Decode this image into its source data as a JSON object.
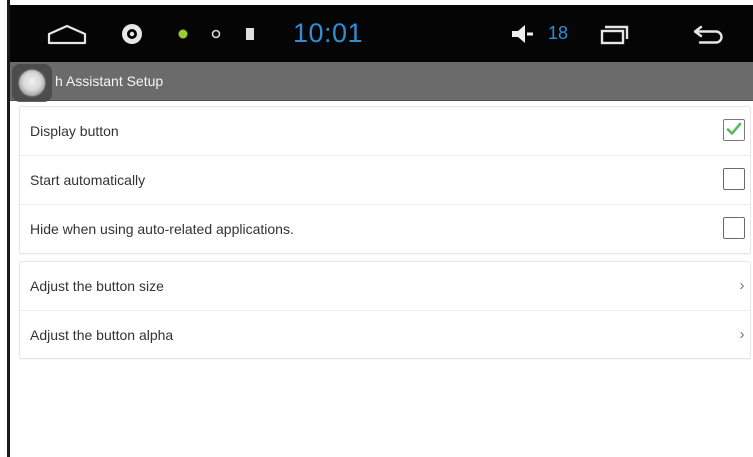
{
  "statusbar": {
    "time": "10:01",
    "volume_level": "18",
    "icons": [
      "home-icon",
      "settings-icon",
      "notification-dot-green-icon",
      "notification-dot-white-icon",
      "sd-card-icon",
      "volume-icon",
      "recent-apps-icon",
      "back-icon"
    ],
    "time_color": "#2f8ed6"
  },
  "titlebar": {
    "title": "h Assistant Setup"
  },
  "settings": {
    "toggles": [
      {
        "label": "Display button",
        "checked": true
      },
      {
        "label": "Start automatically",
        "checked": false
      },
      {
        "label": "Hide when using auto-related applications.",
        "checked": false
      }
    ],
    "links": [
      {
        "label": "Adjust the button size",
        "chevron": "›"
      },
      {
        "label": "Adjust the button alpha",
        "chevron": "›"
      }
    ]
  },
  "colors": {
    "check_green": "#5cb85c",
    "titlebar_bg": "#6b6b6b",
    "statusbar_bg": "#050505"
  }
}
